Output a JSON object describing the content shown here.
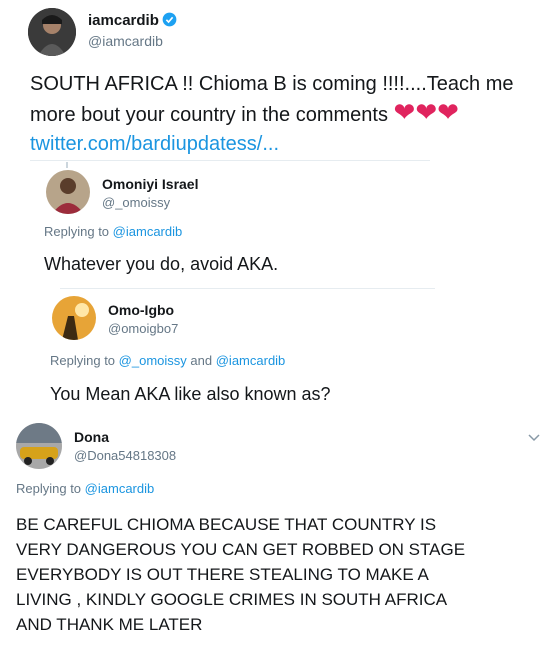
{
  "main_tweet": {
    "display_name": "iamcardib",
    "handle": "@iamcardib",
    "text_line1": "SOUTH AFRICA !! Chioma B is coming !!!!....Teach me",
    "text_line2": "more bout your country in the comments",
    "link": "twitter.com/bardiupdatess/...",
    "verified_color": "#1da1f2"
  },
  "reply1": {
    "display_name": "Omoniyi Israel",
    "handle": "@_omoissy",
    "replying_prefix": "Replying to",
    "replying_to": "@iamcardib",
    "text": "Whatever you do,  avoid AKA."
  },
  "reply2": {
    "display_name": "Omo-Igbo",
    "handle": "@omoigbo7",
    "replying_prefix": "Replying to",
    "replying_to_1": "@_omoissy",
    "replying_and": "and",
    "replying_to_2": "@iamcardib",
    "text": "You Mean AKA like also known as?"
  },
  "reply3": {
    "display_name": "Dona",
    "handle": "@Dona54818308",
    "replying_prefix": "Replying to",
    "replying_to": "@iamcardib",
    "text_lines": [
      "BE CAREFUL CHIOMA BECAUSE THAT COUNTRY IS",
      "VERY DANGEROUS YOU CAN GET ROBBED ON STAGE",
      "EVERYBODY IS OUT THERE STEALING TO MAKE A",
      "LIVING , KINDLY GOOGLE CRIMES IN SOUTH AFRICA",
      "AND THANK ME LATER"
    ]
  },
  "colors": {
    "link": "#1b95e0",
    "muted": "#657786",
    "heart": "#e0245e"
  }
}
